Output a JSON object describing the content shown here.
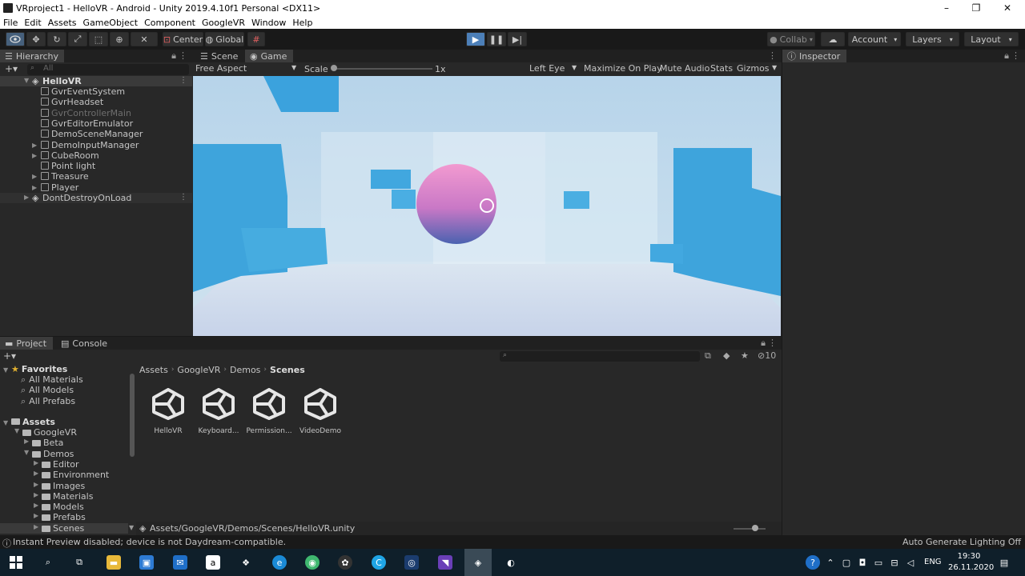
{
  "window": {
    "title": "VRproject1 - HelloVR - Android - Unity 2019.4.10f1 Personal <DX11>",
    "controls": [
      "–",
      "❐",
      "✕"
    ]
  },
  "menu": [
    "File",
    "Edit",
    "Assets",
    "GameObject",
    "Component",
    "GoogleVR",
    "Window",
    "Help"
  ],
  "toolbar": {
    "pivot_label": "Center",
    "space_label": "Global",
    "collab_label": "Collab",
    "account_label": "Account",
    "layers_label": "Layers",
    "layout_label": "Layout",
    "play_color": "#4c7fb8"
  },
  "hierarchy": {
    "tab": "Hierarchy",
    "search_placeholder": "All",
    "scene": "HelloVR",
    "items": [
      {
        "label": "GvrEventSystem",
        "expandable": false,
        "dimmed": false
      },
      {
        "label": "GvrHeadset",
        "expandable": false,
        "dimmed": false
      },
      {
        "label": "GvrControllerMain",
        "expandable": false,
        "dimmed": true
      },
      {
        "label": "GvrEditorEmulator",
        "expandable": false,
        "dimmed": false
      },
      {
        "label": "DemoSceneManager",
        "expandable": false,
        "dimmed": false
      },
      {
        "label": "DemoInputManager",
        "expandable": true,
        "dimmed": false
      },
      {
        "label": "CubeRoom",
        "expandable": true,
        "dimmed": false
      },
      {
        "label": "Point light",
        "expandable": false,
        "dimmed": false
      },
      {
        "label": "Treasure",
        "expandable": true,
        "dimmed": false
      },
      {
        "label": "Player",
        "expandable": true,
        "dimmed": false
      }
    ],
    "dont_destroy": "DontDestroyOnLoad"
  },
  "view": {
    "tab_scene": "Scene",
    "tab_game": "Game",
    "aspect": "Free Aspect",
    "scale_label": "Scale",
    "scale_value": "1x",
    "eye": "Left Eye",
    "maximize": "Maximize On Play",
    "mute": "Mute Audio",
    "stats": "Stats",
    "gizmos": "Gizmos"
  },
  "inspector": {
    "tab": "Inspector"
  },
  "project": {
    "tab_project": "Project",
    "tab_console": "Console",
    "badge_count": "10",
    "favorites_label": "Favorites",
    "favorites": [
      "All Materials",
      "All Models",
      "All Prefabs"
    ],
    "assets_label": "Assets",
    "tree": [
      {
        "label": "GoogleVR",
        "depth": 1,
        "open": true
      },
      {
        "label": "Beta",
        "depth": 2,
        "open": false
      },
      {
        "label": "Demos",
        "depth": 2,
        "open": true
      },
      {
        "label": "Editor",
        "depth": 3,
        "open": false
      },
      {
        "label": "Environment",
        "depth": 3,
        "open": false
      },
      {
        "label": "Images",
        "depth": 3,
        "open": false
      },
      {
        "label": "Materials",
        "depth": 3,
        "open": false
      },
      {
        "label": "Models",
        "depth": 3,
        "open": false
      },
      {
        "label": "Prefabs",
        "depth": 3,
        "open": false
      },
      {
        "label": "Scenes",
        "depth": 3,
        "open": false
      }
    ],
    "breadcrumb": [
      "Assets",
      "GoogleVR",
      "Demos",
      "Scenes"
    ],
    "assets": [
      "HelloVR",
      "Keyboard...",
      "Permission...",
      "VideoDemo"
    ],
    "path": "Assets/GoogleVR/Demos/Scenes/HelloVR.unity"
  },
  "status": {
    "message": "Instant Preview disabled; device is not Daydream-compatible.",
    "lighting": "Auto Generate Lighting Off"
  },
  "taskbar": {
    "lang": "ENG",
    "time": "19:30",
    "date": "26.11.2020"
  }
}
